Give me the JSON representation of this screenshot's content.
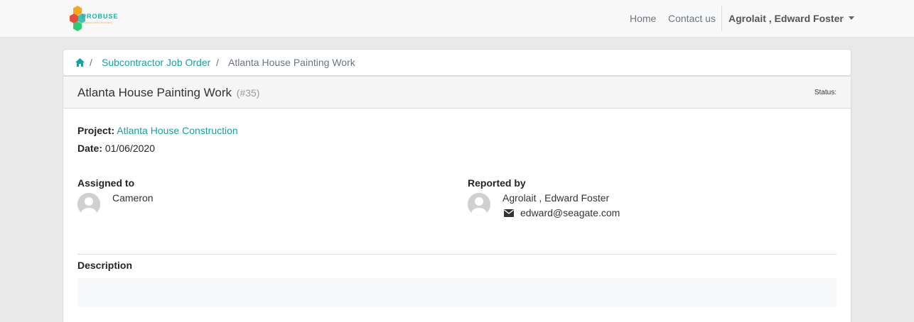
{
  "navbar": {
    "brand_text": "PROBUSE",
    "brand_sub": "PROFESSIONAL BUSINESS",
    "home": "Home",
    "contact": "Contact us",
    "user": "Agrolait , Edward Foster"
  },
  "breadcrumb": {
    "sep": "/",
    "items": [
      "Subcontractor Job Order",
      "Atlanta House Painting Work"
    ]
  },
  "job": {
    "title": "Atlanta House Painting Work",
    "ref": "(#35)",
    "status_label": "Status:",
    "project_label": "Project:",
    "project_value": "Atlanta House Construction",
    "date_label": "Date:",
    "date_value": "01/06/2020"
  },
  "assigned": {
    "label": "Assigned to",
    "name": "Cameron"
  },
  "reported": {
    "label": "Reported by",
    "name": "Agrolait , Edward Foster",
    "email": "edward@seagate.com"
  },
  "description": {
    "label": "Description",
    "text": ""
  },
  "colors": {
    "accent": "#17a2a0",
    "background": "#e9e9e9"
  }
}
